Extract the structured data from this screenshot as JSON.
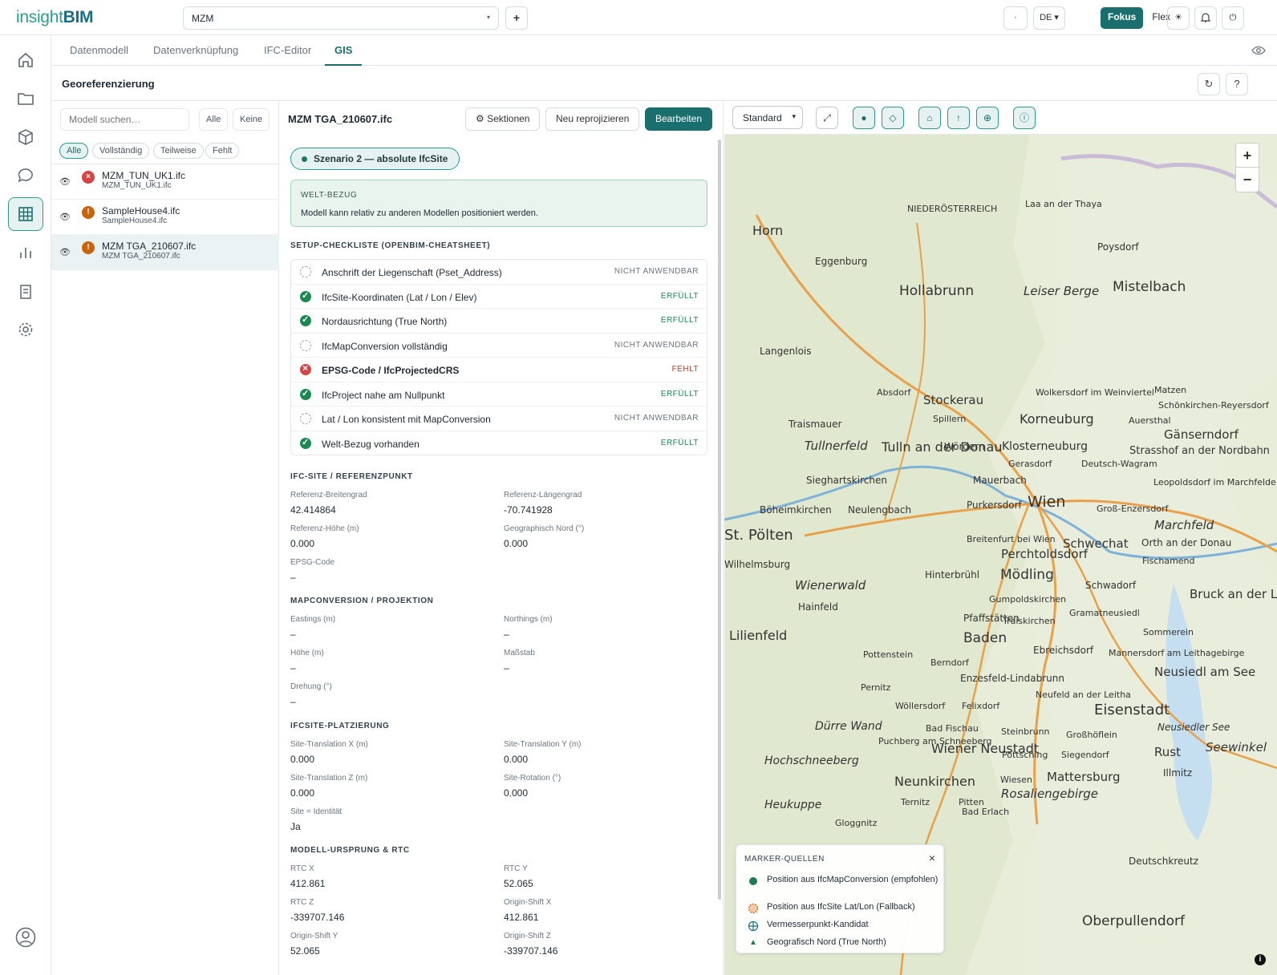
{
  "app": {
    "logo_a": "insight",
    "logo_b": "BIM",
    "project": "MZM",
    "add": "+",
    "lang": "DE",
    "mode_focus": "Fokus",
    "mode_flex": "Flex"
  },
  "tabs": [
    "Datenmodell",
    "Datenverknüpfung",
    "IFC-Editor",
    "GIS"
  ],
  "header": {
    "title": "Georeferenzierung"
  },
  "left": {
    "search_placeholder": "Modell suchen…",
    "all": "Alle",
    "none": "Keine",
    "filters": [
      "Alle",
      "Vollständig",
      "Teilweise",
      "Fehlt"
    ],
    "files": [
      {
        "name": "MZM_TUN_UK1.ifc",
        "sub": "MZM_TUN_UK1.ifc",
        "status": "error"
      },
      {
        "name": "SampleHouse4.ifc",
        "sub": "SampleHouse4.ifc",
        "status": "warning"
      },
      {
        "name": "MZM TGA_210607.ifc",
        "sub": "MZM TGA_210607.ifc",
        "status": "warning"
      }
    ]
  },
  "mid": {
    "title": "MZM TGA_210607.ifc",
    "btn_sections": "⚙ Sektionen",
    "btn_reproject": "Neu reprojizieren",
    "btn_edit": "Bearbeiten",
    "scenario": "Szenario 2 — absolute IfcSite",
    "welt_key": "WELT-BEZUG",
    "welt_val": "Modell kann relativ zu anderen Modellen positioniert werden.",
    "checklist_title": "SETUP-CHECKLISTE (OPENBIM-CHEATSHEET)",
    "checklist": [
      {
        "label": "Anschrift der Liegenschaft (Pset_Address)",
        "status": "NICHT ANWENDBAR",
        "kind": "na"
      },
      {
        "label": "IfcSite-Koordinaten (Lat / Lon / Elev)",
        "status": "ERFÜLLT",
        "kind": "ok"
      },
      {
        "label": "Nordausrichtung (True North)",
        "status": "ERFÜLLT",
        "kind": "ok"
      },
      {
        "label": "IfcMapConversion vollständig",
        "status": "NICHT ANWENDBAR",
        "kind": "na"
      },
      {
        "label": "EPSG-Code / IfcProjectedCRS",
        "status": "FEHLT",
        "kind": "err"
      },
      {
        "label": "IfcProject nahe am Nullpunkt",
        "status": "ERFÜLLT",
        "kind": "ok"
      },
      {
        "label": "Lat / Lon konsistent mit MapConversion",
        "status": "NICHT ANWENDBAR",
        "kind": "na"
      },
      {
        "label": "Welt-Bezug vorhanden",
        "status": "ERFÜLLT",
        "kind": "ok"
      }
    ],
    "sections": [
      {
        "title": "IFC-SITE / REFERENZPUNKT",
        "fields": [
          {
            "l": "Referenz-Breitengrad",
            "v": "42.414864"
          },
          {
            "l": "Referenz-Längengrad",
            "v": "-70.741928"
          },
          {
            "l": "Referenz-Höhe (m)",
            "v": "0.000"
          },
          {
            "l": "Geographisch Nord (°)",
            "v": "0.000"
          },
          {
            "l": "EPSG-Code",
            "v": "–"
          }
        ]
      },
      {
        "title": "MAPCONVERSION / PROJEKTION",
        "fields": [
          {
            "l": "Eastings (m)",
            "v": "–"
          },
          {
            "l": "Northings (m)",
            "v": "–"
          },
          {
            "l": "Höhe (m)",
            "v": "–"
          },
          {
            "l": "Maßstab",
            "v": "–"
          },
          {
            "l": "Drehung (°)",
            "v": "–"
          }
        ]
      },
      {
        "title": "IFCSITE-PLATZIERUNG",
        "fields": [
          {
            "l": "Site-Translation X (m)",
            "v": "0.000"
          },
          {
            "l": "Site-Translation Y (m)",
            "v": "0.000"
          },
          {
            "l": "Site-Translation Z (m)",
            "v": "0.000"
          },
          {
            "l": "Site-Rotation (°)",
            "v": "0.000"
          },
          {
            "l": "Site = Identität",
            "v": "Ja"
          }
        ]
      },
      {
        "title": "MODELL-URSPRUNG & RTC",
        "fields": [
          {
            "l": "RTC X",
            "v": "412.861"
          },
          {
            "l": "RTC Y",
            "v": "52.065"
          },
          {
            "l": "RTC Z",
            "v": "-339707.146"
          },
          {
            "l": "Origin-Shift X",
            "v": "412.861"
          },
          {
            "l": "Origin-Shift Y",
            "v": "52.065"
          },
          {
            "l": "Origin-Shift Z",
            "v": "-339707.146"
          }
        ]
      }
    ]
  },
  "map": {
    "style": "Standard",
    "zoom_in": "+",
    "zoom_out": "−",
    "legend_title": "MARKER-QUELLEN",
    "legend_close": "×",
    "legend": [
      "Position aus IfcMapConversion (empfohlen)",
      "Position aus IfcSite Lat/Lon (Fallback)",
      "Vermesserpunkt-Kandidat",
      "Geografisch Nord (True North)"
    ],
    "labels": [
      "Horn",
      "Hollabrunn",
      "Mistelbach",
      "Leiser Berge",
      "Eggenburg",
      "Poysdorf",
      "NIEDERÖSTERREICH",
      "Laa an der Thaya",
      "Langenlois",
      "Absdorf",
      "Stockerau",
      "Wolkersdorf im Weinviertel",
      "Matzen",
      "Schönkirchen-Reyersdorf",
      "Korneuburg",
      "Auersthal",
      "Gänserndorf",
      "Spillern",
      "Traismauer",
      "Tullnerfeld",
      "Tulln an der Donau",
      "Wördern",
      "Klosterneuburg",
      "Gerasdorf",
      "Deutsch-Wagram",
      "Strasshof an der Nordbahn",
      "Leopoldsdorf im Marchfelde",
      "Sieghartskirchen",
      "Mauerbach",
      "Böheimkirchen",
      "Neulengbach",
      "Purkersdorf",
      "Wien",
      "Groß-Enzersdorf",
      "Marchfeld",
      "St. Pölten",
      "Breitenfurt bei Wien",
      "Perchtoldsdorf",
      "Schwechat",
      "Orth an der Donau",
      "Fischamend",
      "Wilhelmsburg",
      "Wienerwald",
      "Hinterbrühl",
      "Mödling",
      "Schwadorf",
      "Bruck an der Leitha",
      "Hainfeld",
      "Gumpoldskirchen",
      "Gramatneusiedl",
      "Lilienfeld",
      "Pfaffstätten",
      "Traiskirchen",
      "Sommerein",
      "Baden",
      "Ebreichsdorf",
      "Mannersdorf am Leithagebirge",
      "Pottenstein",
      "Berndorf",
      "Neusiedl am See",
      "Enzesfeld-Lindabrunn",
      "Pernitz",
      "Neufeld an der Leitha",
      "Wöllersdorf",
      "Felixdorf",
      "Eisenstadt",
      "Dürre Wand",
      "Bad Fischau",
      "Steinbrunn",
      "Großhöflein",
      "Neusiedler See",
      "Puchberg am Schneeberg",
      "Wiener Neustadt",
      "Pöttsching",
      "Siegendorf",
      "Rust",
      "Seewinkel",
      "Hochschneeberg",
      "Illmitz",
      "Neunkirchen",
      "Wiesen",
      "Mattersburg",
      "Ternitz",
      "Pitten",
      "Bad Erlach",
      "Rosaliengebirge",
      "Heukuppe",
      "Gloggnitz",
      "Deutschkreutz",
      "Oberpullendorf"
    ]
  }
}
